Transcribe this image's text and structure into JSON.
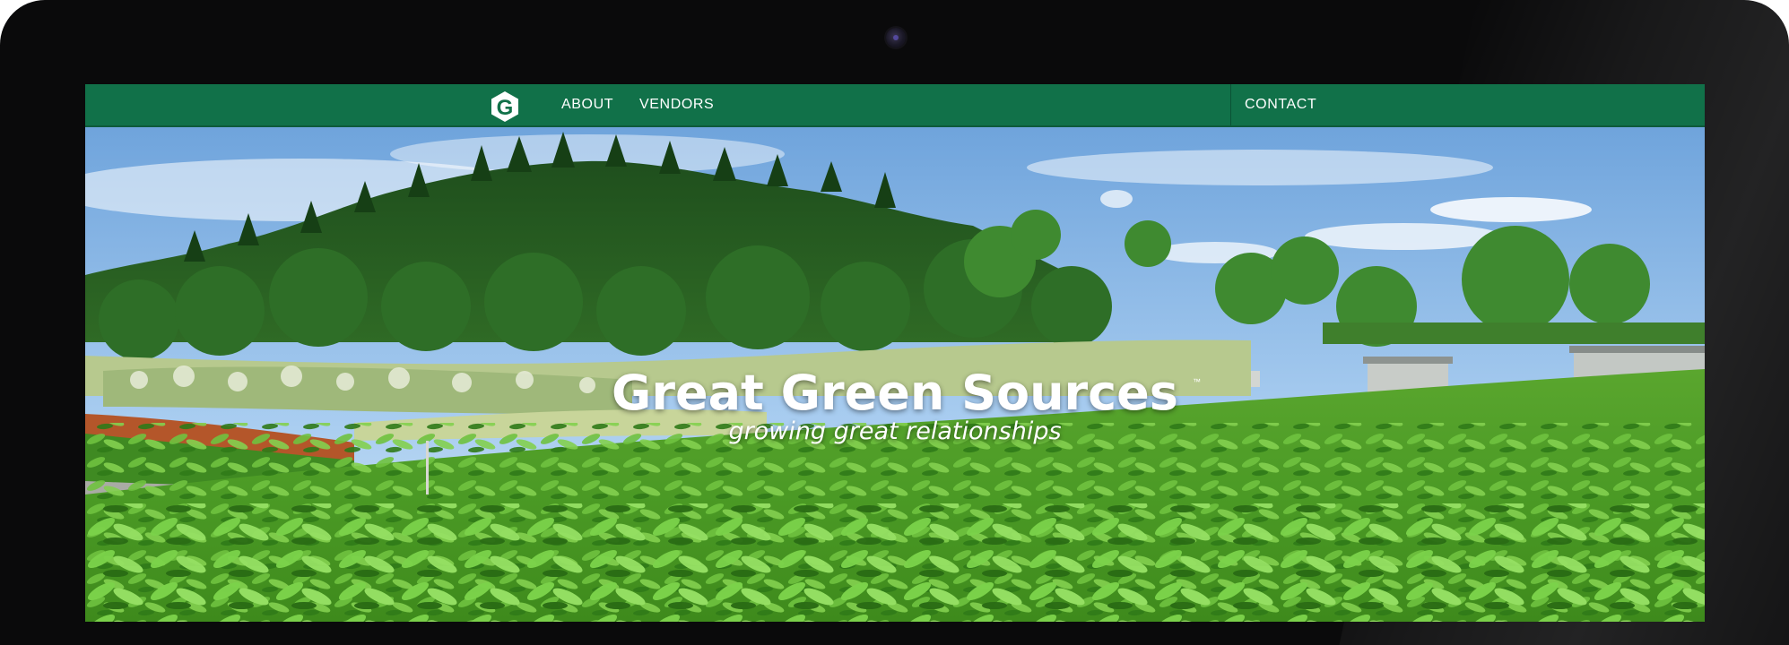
{
  "nav": {
    "logo_letter": "G",
    "about_label": "ABOUT",
    "vendors_label": "VENDORS",
    "contact_label": "CONTACT"
  },
  "hero": {
    "title": "Great Green Sources",
    "trademark": "™",
    "subtitle": "growing great relationships"
  },
  "colors": {
    "nav_green": "#117149",
    "bezel": "#0a0a0b",
    "sky": "#7fb0e0",
    "foliage": "#4caa2c"
  }
}
